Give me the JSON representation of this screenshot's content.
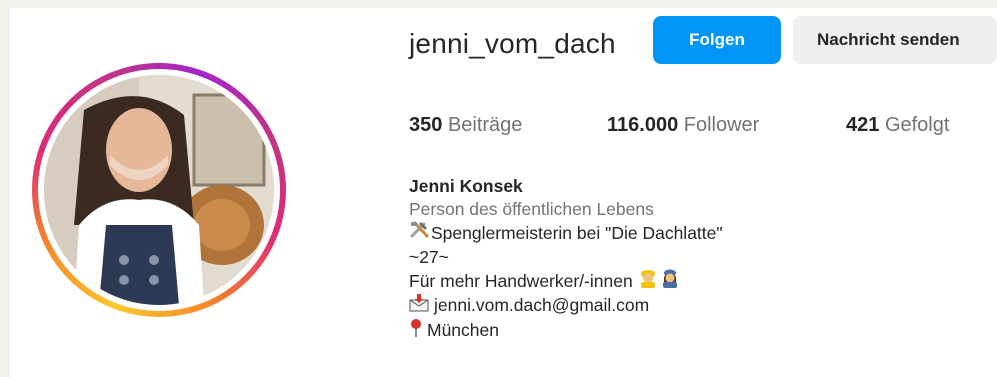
{
  "profile": {
    "username": "jenni_vom_dach",
    "follow_label": "Folgen",
    "message_label": "Nachricht senden"
  },
  "stats": {
    "posts_count": "350",
    "posts_label": "Beiträge",
    "followers_count": "116.000",
    "followers_label": "Follower",
    "following_count": "421",
    "following_label": "Gefolgt"
  },
  "bio": {
    "name": "Jenni Konsek",
    "category": "Person des öffentlichen Lebens",
    "line1": "Spenglermeisterin bei \"Die Dachlatte\"",
    "line2": "~27~",
    "line3": "Für mehr Handwerker/-innen",
    "email": "jenni.vom.dach@gmail.com",
    "location": "München"
  },
  "icons": {
    "tools": "hammer-and-wrench-icon",
    "workers": "construction-worker-icon",
    "mail": "envelope-icon",
    "location": "round-pushpin-icon"
  },
  "colors": {
    "follow_button": "#0095f6",
    "message_button": "#efefef",
    "secondary_text": "#737373",
    "story_ring": [
      "#fdc830",
      "#f58529",
      "#dd2a7b",
      "#a425c8"
    ]
  }
}
